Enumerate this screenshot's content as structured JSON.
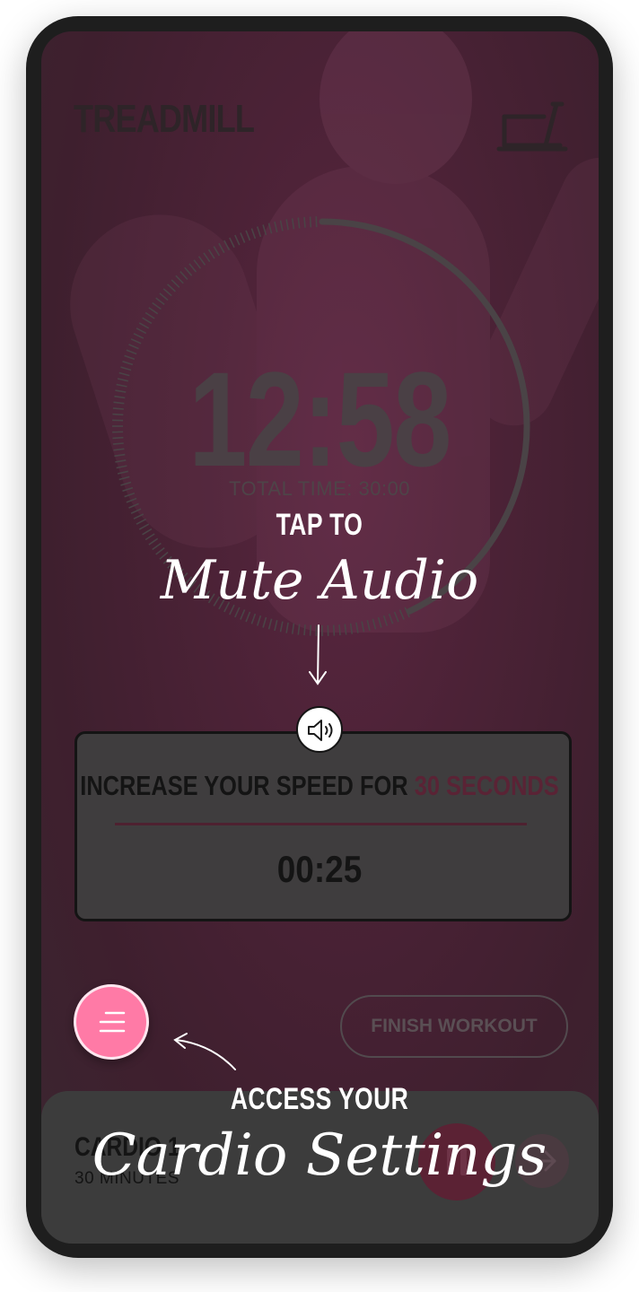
{
  "app": {
    "title": "TREADMILL"
  },
  "timer": {
    "remaining": "12:58",
    "total_label": "TOTAL TIME: 30:00",
    "progress_fraction": 0.43
  },
  "interval_card": {
    "message_prefix": "INCREASE YOUR SPEED FOR ",
    "message_highlight": "30 SECONDS",
    "countdown": "00:25"
  },
  "buttons": {
    "finish_label": "FINISH WORKOUT"
  },
  "bottom_bar": {
    "workout_name": "CARDIO 1",
    "workout_duration": "30 MINUTES"
  },
  "annotations": {
    "mute_top": "TAP TO",
    "mute_script": "Mute Audio",
    "settings_top": "ACCESS YOUR",
    "settings_script": "Cardio Settings"
  },
  "colors": {
    "accent_pink": "#ff7aa6",
    "highlight_maroon": "#5a2335",
    "overlay_dark": "#3c3c3c"
  },
  "icons": {
    "header": "treadmill-icon",
    "audio": "speaker-icon",
    "menu": "menu-lines-icon",
    "play": "pause-icon",
    "next": "arrow-right-icon"
  }
}
